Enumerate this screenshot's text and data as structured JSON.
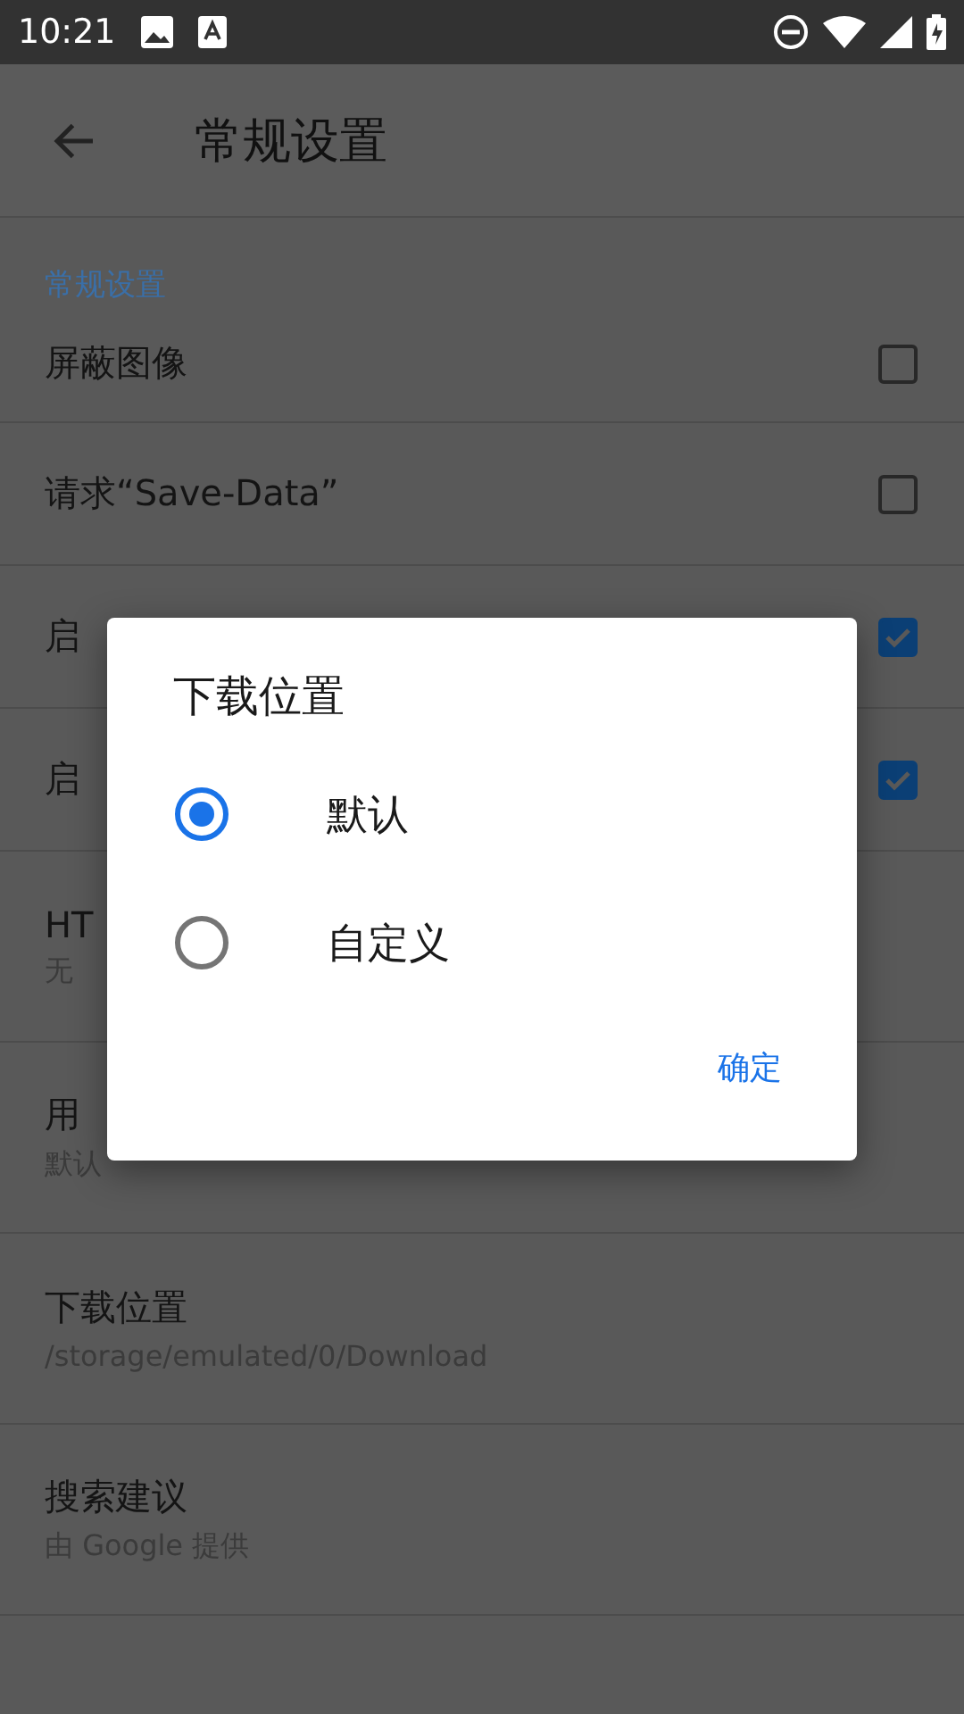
{
  "status_bar": {
    "time": "10:21"
  },
  "app_bar": {
    "title": "常规设置"
  },
  "category": "常规设置",
  "settings": [
    {
      "kind": "checkbox",
      "title": "屏蔽图像",
      "checked": false
    },
    {
      "kind": "checkbox",
      "title": "请求“Save-Data”",
      "checked": false
    },
    {
      "kind": "checkbox",
      "title": "启",
      "checked": true
    },
    {
      "kind": "checkbox",
      "title": "启",
      "checked": true
    },
    {
      "kind": "text",
      "title": "HT",
      "summary": "无"
    },
    {
      "kind": "text",
      "title": "用",
      "summary": "默认"
    },
    {
      "kind": "text",
      "title": "下载位置",
      "summary": "/storage/emulated/0/Download"
    },
    {
      "kind": "text",
      "title": "搜索建议",
      "summary": "由 Google 提供"
    }
  ],
  "dialog": {
    "title": "下载位置",
    "options": [
      {
        "label": "默认",
        "selected": true
      },
      {
        "label": "自定义",
        "selected": false
      }
    ],
    "button": "确定"
  }
}
